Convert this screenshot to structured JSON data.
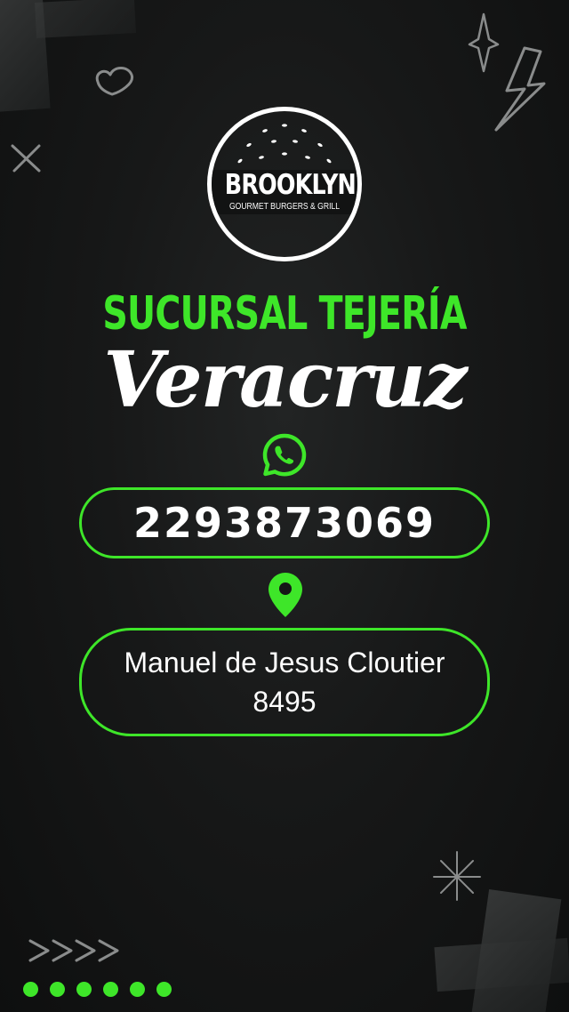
{
  "logo": {
    "brand": "BROOKLYN",
    "tagline": "GOURMET BURGERS & GRILL"
  },
  "title": {
    "branch": "SUCURSAL TEJERÍA",
    "city": "Veracruz"
  },
  "contact": {
    "whatsapp_icon": "whatsapp-icon",
    "phone": "2293873069",
    "location_icon": "map-pin-icon",
    "address": "Manuel de Jesus Cloutier 8495"
  },
  "colors": {
    "accent": "#3ee629",
    "background": "#121313",
    "text": "#ffffff"
  }
}
